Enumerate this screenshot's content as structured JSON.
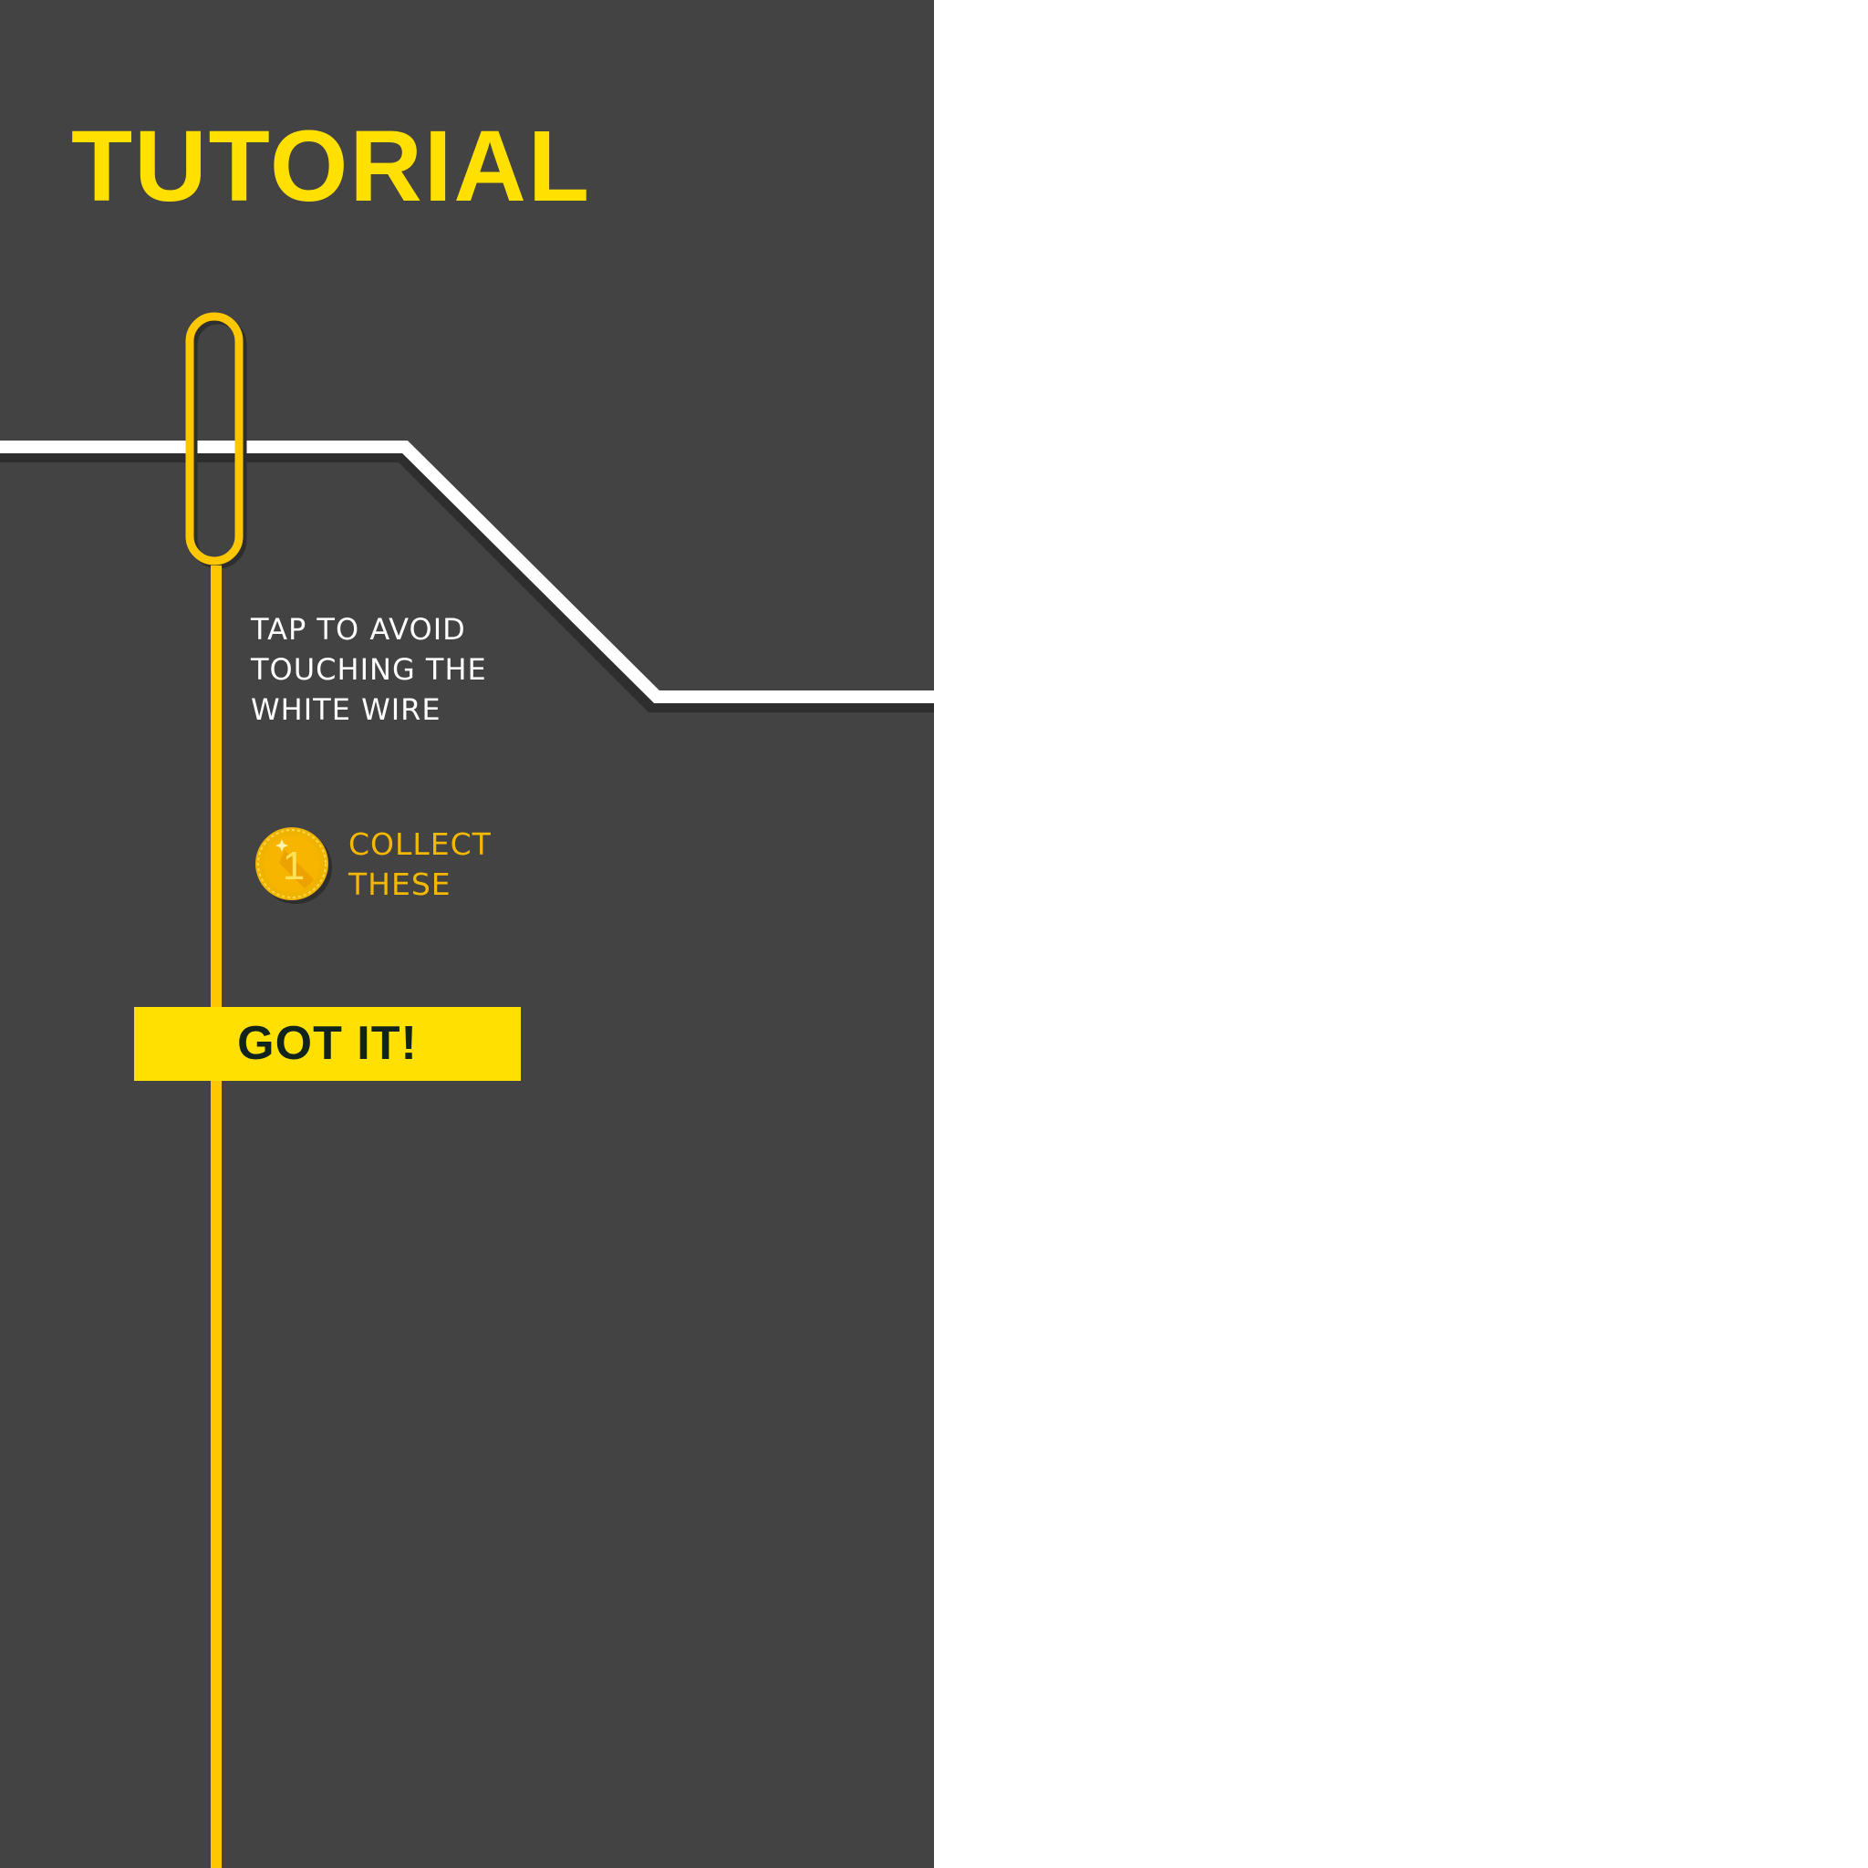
{
  "tutorial": {
    "title": "TUTORIAL",
    "instruction_lines": [
      "TAP TO AVOID",
      "TOUCHING THE",
      "WHITE WIRE"
    ],
    "collect_lines": [
      "COLLECT",
      "THESE"
    ],
    "coin_value": "1",
    "button_label": "GOT IT!"
  },
  "colors": {
    "background": "#434343",
    "accent_yellow": "#ffe000",
    "loop_yellow": "#ffc700",
    "coin_text": "#f5b800",
    "wire_white": "#ffffff",
    "wire_shadow": "#2e2e2e",
    "button_text": "#10241c",
    "outside_area": "#ffffff"
  },
  "icons": {
    "coin": "gold-coin-icon",
    "loop": "wire-loop-icon"
  }
}
